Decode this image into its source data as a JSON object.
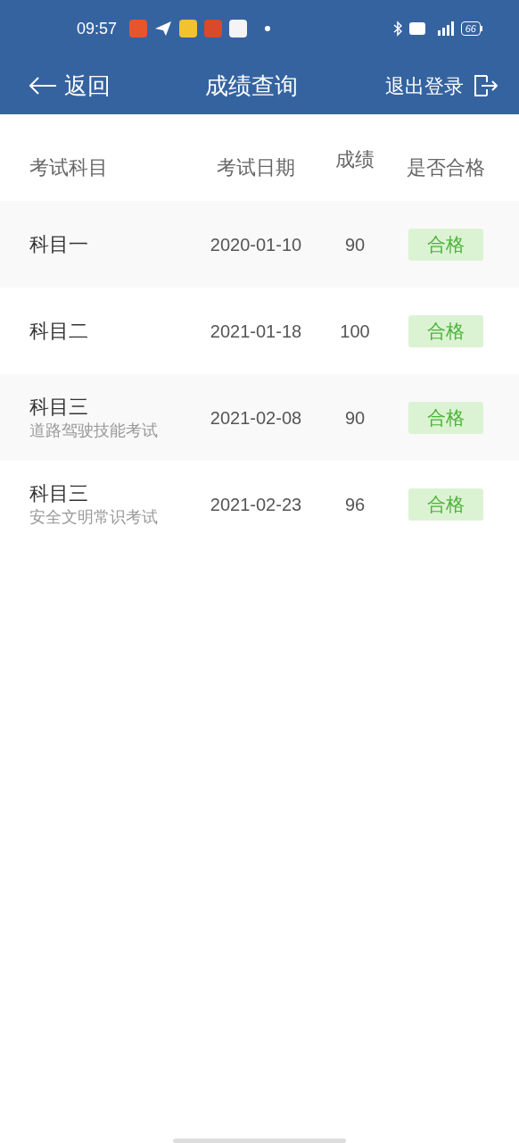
{
  "status_bar": {
    "time": "09:57",
    "battery": "66"
  },
  "nav": {
    "back": "返回",
    "title": "成绩查询",
    "logout": "退出登录"
  },
  "table": {
    "columns": [
      "考试科目",
      "考试日期",
      "成绩",
      "是否合格"
    ],
    "rows": [
      {
        "subject": "科目一",
        "date": "2020-01-10",
        "score": "90",
        "result": "合格"
      },
      {
        "subject": "科目二",
        "date": "2021-01-18",
        "score": "100",
        "result": "合格"
      },
      {
        "subject": "科目三",
        "subtitle": "道路驾驶技能考试",
        "date": "2021-02-08",
        "score": "90",
        "result": "合格"
      },
      {
        "subject": "科目三",
        "subtitle": "安全文明常识考试",
        "date": "2021-02-23",
        "score": "96",
        "result": "合格"
      }
    ]
  }
}
